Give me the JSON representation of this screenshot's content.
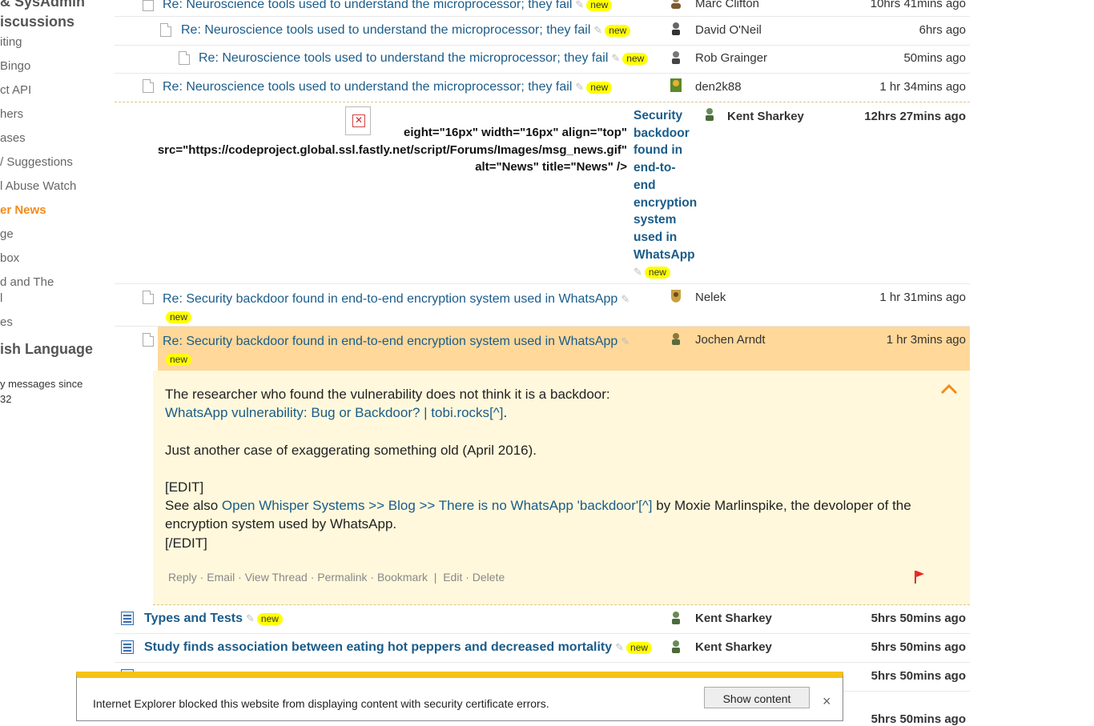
{
  "sidebar": {
    "items": [
      {
        "label": "& SysAdmin",
        "style": "head"
      },
      {
        "label": "iscussions",
        "style": "head"
      },
      {
        "label": "iting",
        "style": "normal"
      },
      {
        "label": "Bingo",
        "style": "normal"
      },
      {
        "label": "ct API",
        "style": "normal"
      },
      {
        "label": "hers",
        "style": "normal"
      },
      {
        "label": "ases",
        "style": "normal"
      },
      {
        "label": "/ Suggestions",
        "style": "normal"
      },
      {
        "label": "l Abuse Watch",
        "style": "normal"
      },
      {
        "label": "er News",
        "style": "active"
      },
      {
        "label": "ge",
        "style": "normal"
      },
      {
        "label": "box",
        "style": "normal"
      },
      {
        "label": "d and The",
        "style": "normal"
      },
      {
        "label": "l",
        "style": "normal"
      },
      {
        "label": "es",
        "style": "normal"
      },
      {
        "label": "ish Language",
        "style": "head"
      },
      {
        "label": "y messages since",
        "style": "small"
      },
      {
        "label": "32",
        "style": "small"
      }
    ]
  },
  "new_badge": "new",
  "rows": [
    {
      "subject": "Re: Neuroscience tools used to understand the microprocessor; they fail",
      "author": "Marc Clifton",
      "time": "10hrs 41mins ago"
    },
    {
      "subject": "Re: Neuroscience tools used to understand the microprocessor; they fail",
      "author": "David O'Neil",
      "time": "6hrs ago"
    },
    {
      "subject": "Re: Neuroscience tools used to understand the microprocessor; they fail",
      "author": "Rob Grainger",
      "time": "50mins ago"
    },
    {
      "subject": "Re: Neuroscience tools used to understand the microprocessor; they fail",
      "author": "den2k88",
      "time": "1 hr 34mins ago"
    }
  ],
  "news_post": {
    "raw_html_lines": [
      "eight=\"16px\" width=\"16px\" align=\"top\"",
      "src=\"https://codeproject.global.ssl.fastly.net/script/Forums/Images/msg_news.gif\"",
      "alt=\"News\" title=\"News\" />"
    ],
    "subject_lines": [
      "Security",
      "backdoor",
      "found in",
      "end-to-",
      "end",
      "encryption",
      "system",
      "used in",
      "WhatsApp"
    ],
    "author": "Kent Sharkey",
    "time": "12hrs 27mins ago"
  },
  "replies": [
    {
      "subject": "Re: Security backdoor found in end-to-end encryption system used in WhatsApp",
      "author": "Nelek",
      "time": "1 hr 31mins ago"
    },
    {
      "subject": "Re: Security backdoor found in end-to-end encryption system used in WhatsApp",
      "author": "Jochen Arndt",
      "time": "1 hr 3mins ago"
    }
  ],
  "message": {
    "line1": "The researcher who found the vulnerability does not think it is a backdoor:",
    "link1": "WhatsApp vulnerability: Bug or Backdoor? | tobi.rocks",
    "ext_marker": "[^]",
    "line1_end": ".",
    "line2": "Just another case of exaggerating something old (April 2016).",
    "edit_open": "[EDIT]",
    "see_also": "See also ",
    "link2": "Open Whisper Systems >> Blog >> There is no WhatsApp 'backdoor'",
    "line3_rest": " by Moxie Marlinspike, the devoloper of the encryption system used by WhatsApp.",
    "edit_close": "[/EDIT]",
    "actions": {
      "reply": "Reply",
      "email": "Email",
      "view_thread": "View Thread",
      "permalink": "Permalink",
      "bookmark": "Bookmark",
      "edit": "Edit",
      "delete": "Delete"
    }
  },
  "news_rows": [
    {
      "subject": "Types and Tests",
      "author": "Kent Sharkey",
      "time": "5hrs 50mins ago"
    },
    {
      "subject": "Study finds association between eating hot peppers and decreased mortality",
      "author": "Kent Sharkey",
      "time": "5hrs 50mins ago"
    },
    {
      "subject": "",
      "author": "",
      "time": "5hrs 50mins ago"
    },
    {
      "subject": "",
      "author": "",
      "time": "5hrs 50mins ago"
    }
  ],
  "ie_bar": {
    "message": "Internet Explorer blocked this website from displaying content with security certificate errors.",
    "button": "Show content",
    "close": "×"
  },
  "colors": {
    "link": "#1a5c8a",
    "active_nav": "#f48a1a",
    "highlight_row": "#ffd89a",
    "message_bg": "#fff8dc",
    "new_badge": "#ffff00",
    "ie_bar_accent": "#f6c215"
  }
}
